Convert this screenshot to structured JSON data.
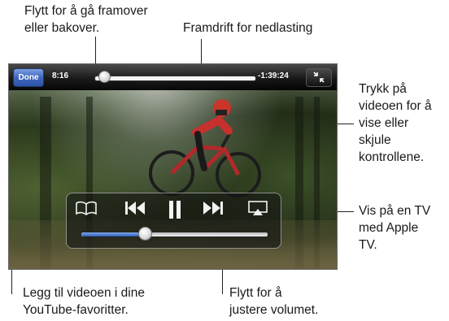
{
  "callouts": {
    "scrub": "Flytt for å gå framover\neller bakover.",
    "download_progress": "Framdrift for nedlasting",
    "tap_video": "Trykk på\nvideoen for å\nvise eller\nskjule\nkontrollene.",
    "airplay": "Vis på en TV\nmed Apple\nTV.",
    "bookmark": "Legg til videoen i dine\nYouTube-favoritter.",
    "volume": "Flytt for å\njustere volumet."
  },
  "player": {
    "done_label": "Done",
    "elapsed": "8:16",
    "remaining": "-1:39:24",
    "playhead_fraction": 0.06,
    "download_fraction": 1.0,
    "volume_fraction": 0.34
  },
  "icons": {
    "bookmark": "open-book-icon",
    "previous": "skip-back-icon",
    "pause": "pause-icon",
    "next": "skip-forward-icon",
    "airplay": "airplay-icon",
    "fullscreen": "shrink-fullscreen-icon"
  },
  "colors": {
    "done_button": "#3f67bf",
    "volume_fill": "#2e5fb8"
  }
}
